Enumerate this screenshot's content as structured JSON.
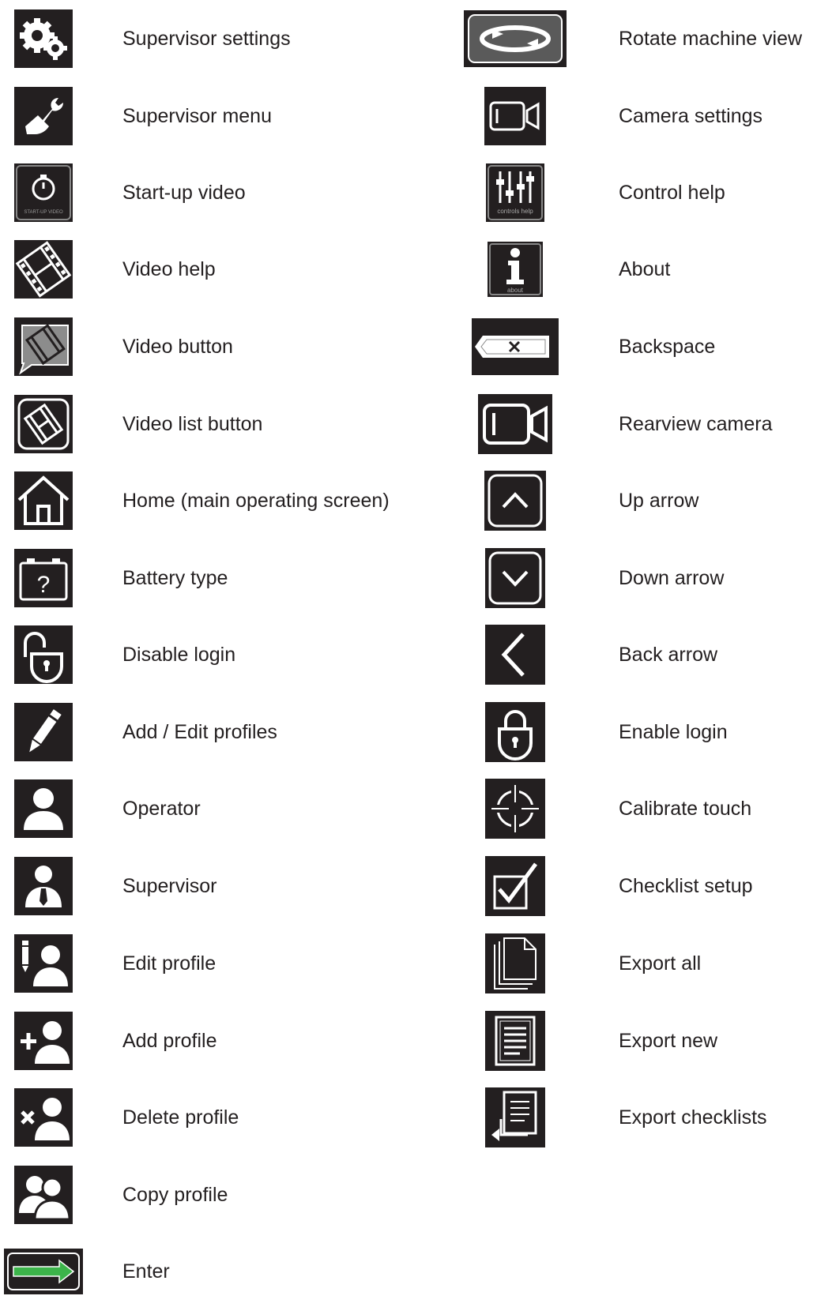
{
  "left_column": [
    {
      "label": "Supervisor settings",
      "icon": "gears-icon"
    },
    {
      "label": "Supervisor menu",
      "icon": "wrench-hand-icon"
    },
    {
      "label": "Start-up video",
      "icon": "stopwatch-icon"
    },
    {
      "label": "Video help",
      "icon": "film-icon"
    },
    {
      "label": "Video button",
      "icon": "film-speech-icon"
    },
    {
      "label": "Video list button",
      "icon": "film-list-icon"
    },
    {
      "label": "Home (main operating screen)",
      "icon": "home-icon"
    },
    {
      "label": "Battery type",
      "icon": "battery-question-icon"
    },
    {
      "label": "Disable login",
      "icon": "unlock-icon"
    },
    {
      "label": "Add / Edit profiles",
      "icon": "pencil-icon"
    },
    {
      "label": "Operator",
      "icon": "operator-icon"
    },
    {
      "label": "Supervisor",
      "icon": "supervisor-icon"
    },
    {
      "label": "Edit profile",
      "icon": "edit-profile-icon"
    },
    {
      "label": "Add profile",
      "icon": "add-profile-icon"
    },
    {
      "label": "Delete profile",
      "icon": "delete-profile-icon"
    },
    {
      "label": "Copy profile",
      "icon": "copy-profile-icon"
    },
    {
      "label": "Enter",
      "icon": "enter-arrow-icon"
    }
  ],
  "right_column": [
    {
      "label": "Rotate machine view",
      "icon": "rotate-icon"
    },
    {
      "label": "Camera settings",
      "icon": "camera-icon"
    },
    {
      "label": "Control help",
      "icon": "sliders-icon"
    },
    {
      "label": "About",
      "icon": "info-icon"
    },
    {
      "label": "Backspace",
      "icon": "backspace-icon"
    },
    {
      "label": "Rearview camera",
      "icon": "camera-large-icon"
    },
    {
      "label": "Up arrow",
      "icon": "chevron-up-icon"
    },
    {
      "label": "Down arrow",
      "icon": "chevron-down-icon"
    },
    {
      "label": "Back arrow",
      "icon": "chevron-left-icon"
    },
    {
      "label": "Enable login",
      "icon": "lock-icon"
    },
    {
      "label": "Calibrate touch",
      "icon": "crosshair-icon"
    },
    {
      "label": "Checklist setup",
      "icon": "checkbox-icon"
    },
    {
      "label": "Export all",
      "icon": "documents-icon"
    },
    {
      "label": "Export new",
      "icon": "document-lines-icon"
    },
    {
      "label": "Export checklists",
      "icon": "export-checklist-icon"
    }
  ],
  "icon_text": {
    "startup": "START-UP VIDEO",
    "controls": "controls help",
    "about": "about"
  },
  "colors": {
    "icon_bg": "#231f20",
    "icon_fg": "#ffffff",
    "enter_green": "#3cb44a",
    "text": "#231f20"
  }
}
